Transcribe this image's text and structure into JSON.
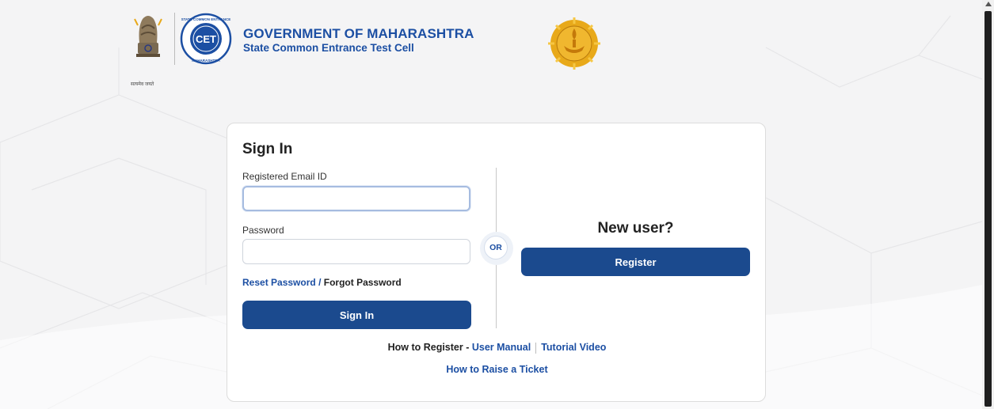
{
  "header": {
    "emblem_caption": "सत्यमेव जयते",
    "title": "GOVERNMENT OF MAHARASHTRA",
    "subtitle": "State Common Entrance Test Cell",
    "cet_logo_text": "CET",
    "cet_ring_top": "STATE COMMON ENTRANCE TEST CELL",
    "cet_ring_bottom": "MAHARASHTRA"
  },
  "signin": {
    "title": "Sign In",
    "email_label": "Registered Email ID",
    "email_value": "",
    "email_placeholder": "",
    "password_label": "Password",
    "password_value": "",
    "password_placeholder": "",
    "reset_link": "Reset Password",
    "separator": "/",
    "forgot_link": "Forgot Password",
    "button_label": "Sign In"
  },
  "divider": {
    "or_label": "OR"
  },
  "register": {
    "heading": "New user?",
    "button_label": "Register"
  },
  "help": {
    "how_to_register": "How to Register -",
    "user_manual": "User Manual",
    "tutorial_video": "Tutorial Video",
    "raise_ticket": "How to Raise a Ticket"
  },
  "colors": {
    "brand_blue": "#1c4fa3",
    "button_blue": "#1b4a8e",
    "seal_gold": "#e8a91a"
  },
  "icons": [
    "national-emblem-icon",
    "cet-logo-icon",
    "maharashtra-seal-icon"
  ]
}
